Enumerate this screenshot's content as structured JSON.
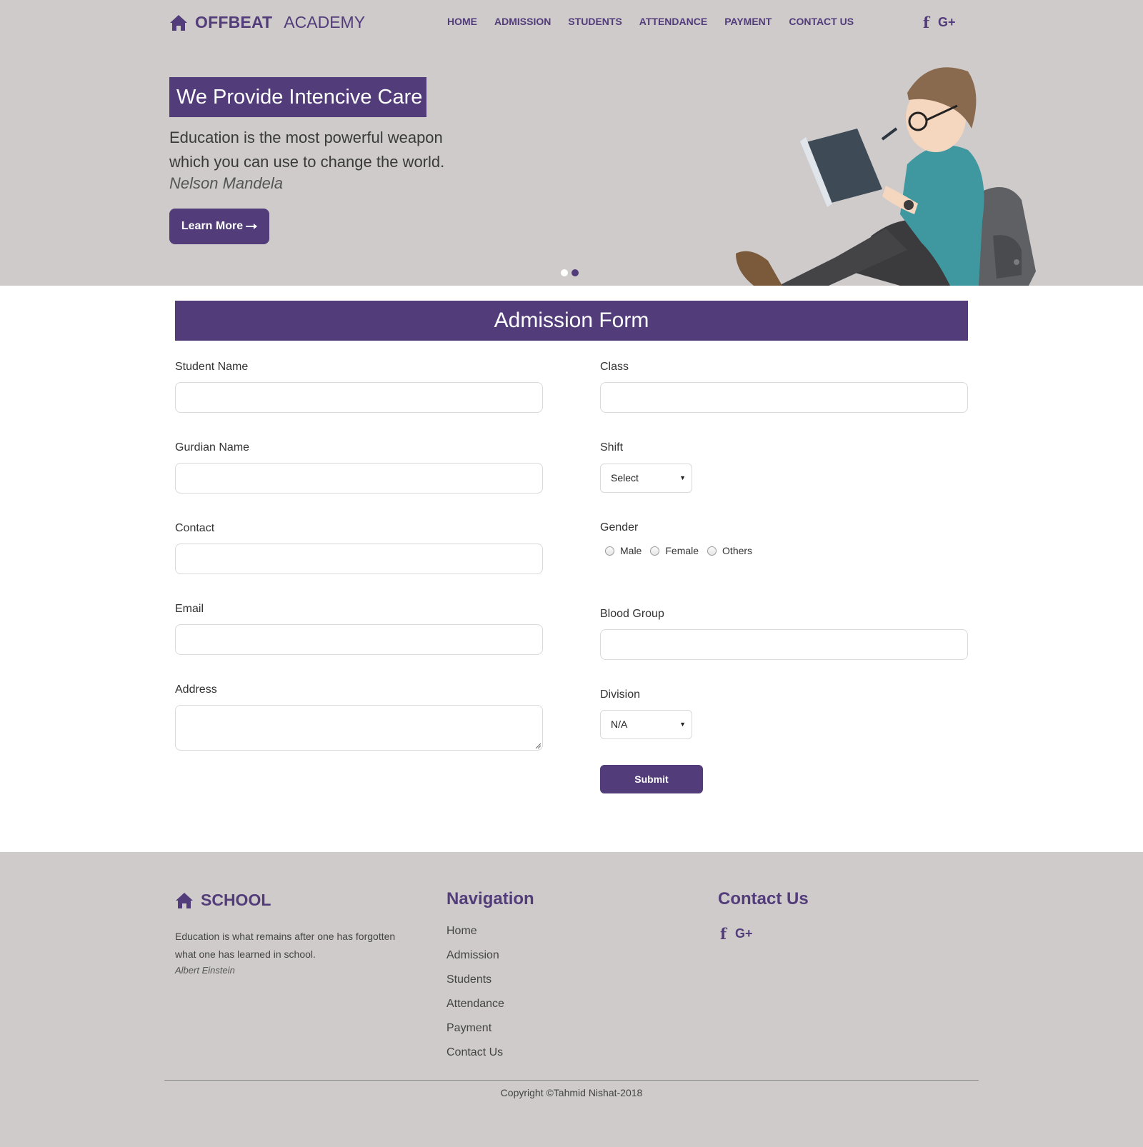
{
  "header": {
    "brand_bold": "OFFBEAT",
    "brand_light": "ACADEMY",
    "nav": [
      "HOME",
      "ADMISSION",
      "STUDENTS",
      "ATTENDANCE",
      "PAYMENT",
      "CONTACT US"
    ],
    "social": {
      "facebook": "f",
      "google": "G+"
    }
  },
  "hero": {
    "headline": "We Provide Intencive Care",
    "quote": "Education is the most powerful weapon which you can use to change the world.",
    "quote_author": "Nelson Mandela",
    "button": "Learn More",
    "button_icon": "arrow-right-icon",
    "slides": 2,
    "active_slide": 2
  },
  "form": {
    "title": "Admission Form",
    "student_name_label": "Student Name",
    "student_name_value": "",
    "guardian_name_label": "Gurdian Name",
    "guardian_name_value": "",
    "contact_label": "Contact",
    "contact_value": "",
    "email_label": "Email",
    "email_value": "",
    "address_label": "Address",
    "address_value": "",
    "class_label": "Class",
    "class_value": "",
    "shift_label": "Shift",
    "shift_selected": "Select",
    "gender_label": "Gender",
    "gender_options": [
      "Male",
      "Female",
      "Others"
    ],
    "blood_group_label": "Blood Group",
    "blood_group_value": "",
    "division_label": "Division",
    "division_selected": "N/A",
    "submit": "Submit"
  },
  "footer": {
    "school_title": "SCHOOL",
    "school_quote": "Education is what remains after one has forgotten what one has learned in school.",
    "school_quote_author": "Albert Einstein",
    "nav_heading": "Navigation",
    "nav_items": [
      "Home",
      "Admission",
      "Students",
      "Attendance",
      "Payment",
      "Contact Us"
    ],
    "contact_heading": "Contact Us",
    "copyright": "Copyright ©Tahmid Nishat-2018"
  },
  "colors": {
    "accent": "#523c7a",
    "panel": "#cfcbcb"
  }
}
